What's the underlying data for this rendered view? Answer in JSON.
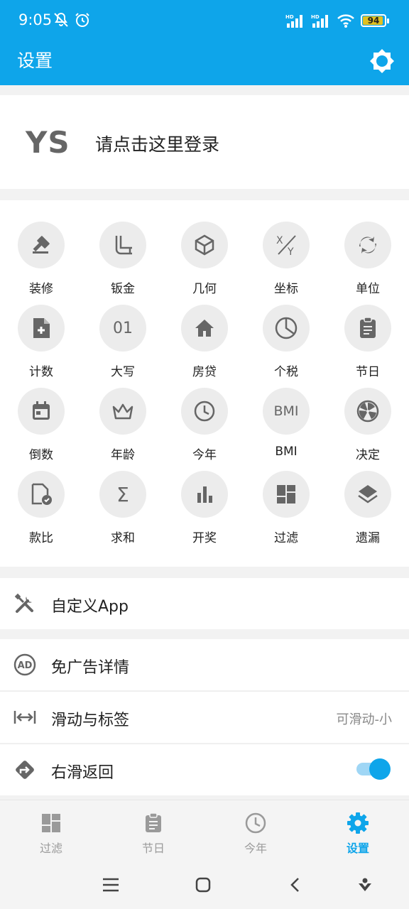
{
  "status_bar": {
    "time": "9:05",
    "battery": "94",
    "battery_level": 0.94
  },
  "app": {
    "title": "设置"
  },
  "login": {
    "avatar_text": "YS",
    "prompt": "请点击这里登录"
  },
  "tools": [
    {
      "label": "装修",
      "icon": "hammer-icon"
    },
    {
      "label": "钣金",
      "icon": "pipe-icon"
    },
    {
      "label": "几何",
      "icon": "cube-icon"
    },
    {
      "label": "坐标",
      "icon": "xy-icon"
    },
    {
      "label": "单位",
      "icon": "swap-icon"
    },
    {
      "label": "计数",
      "icon": "file-plus-icon"
    },
    {
      "label": "大写",
      "icon": "digits-icon",
      "glyph": "01"
    },
    {
      "label": "房贷",
      "icon": "home-icon"
    },
    {
      "label": "个税",
      "icon": "pie-icon"
    },
    {
      "label": "节日",
      "icon": "clipboard-icon"
    },
    {
      "label": "倒数",
      "icon": "calendar-icon"
    },
    {
      "label": "年龄",
      "icon": "crown-icon"
    },
    {
      "label": "今年",
      "icon": "clock-icon"
    },
    {
      "label": "BMI",
      "icon": "bmi-icon",
      "glyph": "BMI"
    },
    {
      "label": "决定",
      "icon": "spinner-icon"
    },
    {
      "label": "款比",
      "icon": "file-check-icon"
    },
    {
      "label": "求和",
      "icon": "sigma-icon",
      "glyph": "Σ"
    },
    {
      "label": "开奖",
      "icon": "bar-chart-icon"
    },
    {
      "label": "过滤",
      "icon": "dashboard-icon"
    },
    {
      "label": "遗漏",
      "icon": "layers-icon"
    }
  ],
  "settings": {
    "custom_app": "自定义App",
    "ad_free": "免广告详情",
    "swipe_tabs": {
      "label": "滑动与标签",
      "value": "可滑动-小"
    },
    "swipe_back": {
      "label": "右滑返回",
      "enabled": true
    }
  },
  "bottom_nav": [
    {
      "label": "过滤",
      "icon": "dashboard-icon",
      "active": false
    },
    {
      "label": "节日",
      "icon": "clipboard-icon",
      "active": false
    },
    {
      "label": "今年",
      "icon": "clock-icon",
      "active": false
    },
    {
      "label": "设置",
      "icon": "gear-icon",
      "active": true
    }
  ],
  "colors": {
    "accent": "#0ea5ea",
    "tile_bg": "#ececec",
    "icon_gray": "#666666"
  }
}
